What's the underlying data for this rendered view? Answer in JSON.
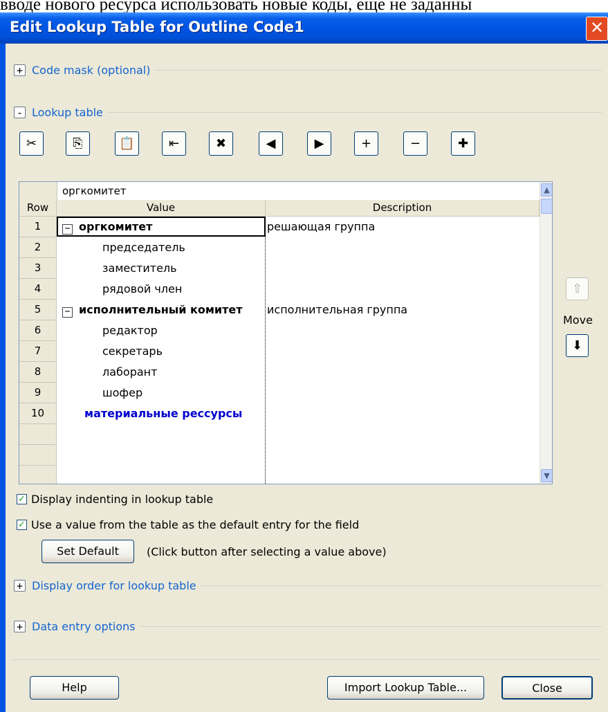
{
  "background_text": "вводе нового ресурса использовать новые коды, еще не заданны",
  "window": {
    "title": "Edit Lookup Table for Outline Code1",
    "close_glyph": "✕"
  },
  "sections": {
    "code_mask": {
      "toggle": "+",
      "label": "Code mask (optional)"
    },
    "lookup_table": {
      "toggle": "-",
      "label": "Lookup table"
    },
    "display_order": {
      "toggle": "+",
      "label": "Display order for lookup table"
    },
    "data_entry": {
      "toggle": "+",
      "label": "Data entry options"
    }
  },
  "toolbar": [
    {
      "name": "cut-icon",
      "glyph": "✂"
    },
    {
      "name": "copy-icon",
      "glyph": "⎘"
    },
    {
      "name": "paste-icon",
      "glyph": "📋"
    },
    {
      "name": "insert-row-icon",
      "glyph": "⇤"
    },
    {
      "name": "delete-row-icon",
      "glyph": "✖"
    },
    {
      "name": "outdent-icon",
      "glyph": "◀"
    },
    {
      "name": "indent-icon",
      "glyph": "▶"
    },
    {
      "name": "expand-icon",
      "glyph": "+"
    },
    {
      "name": "collapse-icon",
      "glyph": "−"
    },
    {
      "name": "expand-all-icon",
      "glyph": "✚"
    }
  ],
  "grid": {
    "edit_value": "оргкомитет",
    "headers": {
      "row": "Row",
      "value": "Value",
      "description": "Description"
    },
    "rows": [
      {
        "num": "1",
        "value": "оргкомитет",
        "description": "решающая группа",
        "level": 0,
        "toggle": "−",
        "style": "bold"
      },
      {
        "num": "2",
        "value": "председатель",
        "description": "",
        "level": 1,
        "toggle": "",
        "style": "normal"
      },
      {
        "num": "3",
        "value": "заместитель",
        "description": "",
        "level": 1,
        "toggle": "",
        "style": "normal"
      },
      {
        "num": "4",
        "value": "рядовой член",
        "description": "",
        "level": 1,
        "toggle": "",
        "style": "normal"
      },
      {
        "num": "5",
        "value": "исполнительный комитет",
        "description": "исполнительная группа",
        "level": 0,
        "toggle": "−",
        "style": "bold"
      },
      {
        "num": "6",
        "value": "редактор",
        "description": "",
        "level": 1,
        "toggle": "",
        "style": "normal"
      },
      {
        "num": "7",
        "value": "секретарь",
        "description": "",
        "level": 1,
        "toggle": "",
        "style": "normal"
      },
      {
        "num": "8",
        "value": "лаборант",
        "description": "",
        "level": 1,
        "toggle": "",
        "style": "normal"
      },
      {
        "num": "9",
        "value": "шофер",
        "description": "",
        "level": 1,
        "toggle": "",
        "style": "normal"
      },
      {
        "num": "10",
        "value": "материальные рессурсы",
        "description": "",
        "level": 0,
        "toggle": "",
        "style": "bold-blue"
      },
      {
        "num": "",
        "value": "",
        "description": "",
        "level": 0,
        "toggle": "",
        "style": "normal"
      },
      {
        "num": "",
        "value": "",
        "description": "",
        "level": 0,
        "toggle": "",
        "style": "normal"
      },
      {
        "num": "",
        "value": "",
        "description": "",
        "level": 0,
        "toggle": "",
        "style": "normal"
      }
    ]
  },
  "move": {
    "label": "Move",
    "up_glyph": "⇧",
    "down_glyph": "⬇"
  },
  "options": {
    "display_indenting": {
      "label": "Display indenting in lookup table",
      "checked": true
    },
    "use_default": {
      "label": "Use a value from the table as the default entry for the field",
      "checked": true
    },
    "set_default_button": "Set Default",
    "set_default_hint": "(Click button after selecting a value above)"
  },
  "buttons": {
    "help": "Help",
    "import": "Import Lookup Table...",
    "close": "Close"
  },
  "colors": {
    "title_bar": "#0054e3",
    "dialog_bg": "#ece9d8",
    "section_link": "#1565d0",
    "blue_row": "#0000d0"
  }
}
